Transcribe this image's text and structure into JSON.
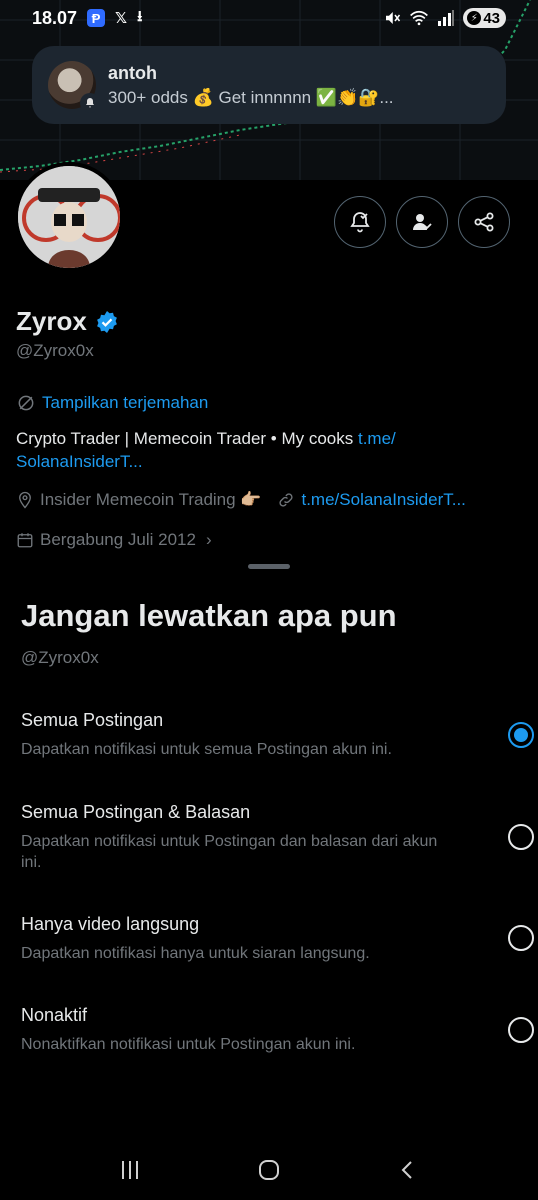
{
  "status_bar": {
    "time": "18.07",
    "battery": "43",
    "icons": [
      "p-app-icon",
      "x-icon",
      "download-icon",
      "mute-icon",
      "wifi-icon",
      "signal-icon",
      "battery-icon"
    ]
  },
  "notification": {
    "title": "antoh",
    "body": "300+ odds 💰 Get innnnnn ✅👏🔐..."
  },
  "profile": {
    "name": "Zyrox",
    "handle": "@Zyrox0x",
    "translate_label": "Tampilkan terjemahan",
    "bio_text": "Crypto Trader | Memecoin Trader • My cooks ",
    "bio_link": "t.me/ SolanaInsiderT...",
    "location": "Insider Memecoin Trading 👉🏼",
    "website": "t.me/SolanaInsiderT...",
    "joined": "Bergabung Juli 2012"
  },
  "sheet": {
    "title": "Jangan lewatkan apa pun",
    "handle": "@Zyrox0x",
    "options": [
      {
        "title": "Semua Postingan",
        "desc": "Dapatkan notifikasi untuk semua Postingan akun ini.",
        "selected": true
      },
      {
        "title": "Semua Postingan & Balasan",
        "desc": "Dapatkan notifikasi untuk Postingan dan balasan dari akun ini.",
        "selected": false
      },
      {
        "title": "Hanya video langsung",
        "desc": "Dapatkan notifikasi hanya untuk siaran langsung.",
        "selected": false
      },
      {
        "title": "Nonaktif",
        "desc": "Nonaktifkan notifikasi untuk Postingan akun ini.",
        "selected": false
      }
    ]
  },
  "colors": {
    "accent": "#1d9bf0",
    "background": "#000000",
    "secondary_text": "#71767b"
  }
}
